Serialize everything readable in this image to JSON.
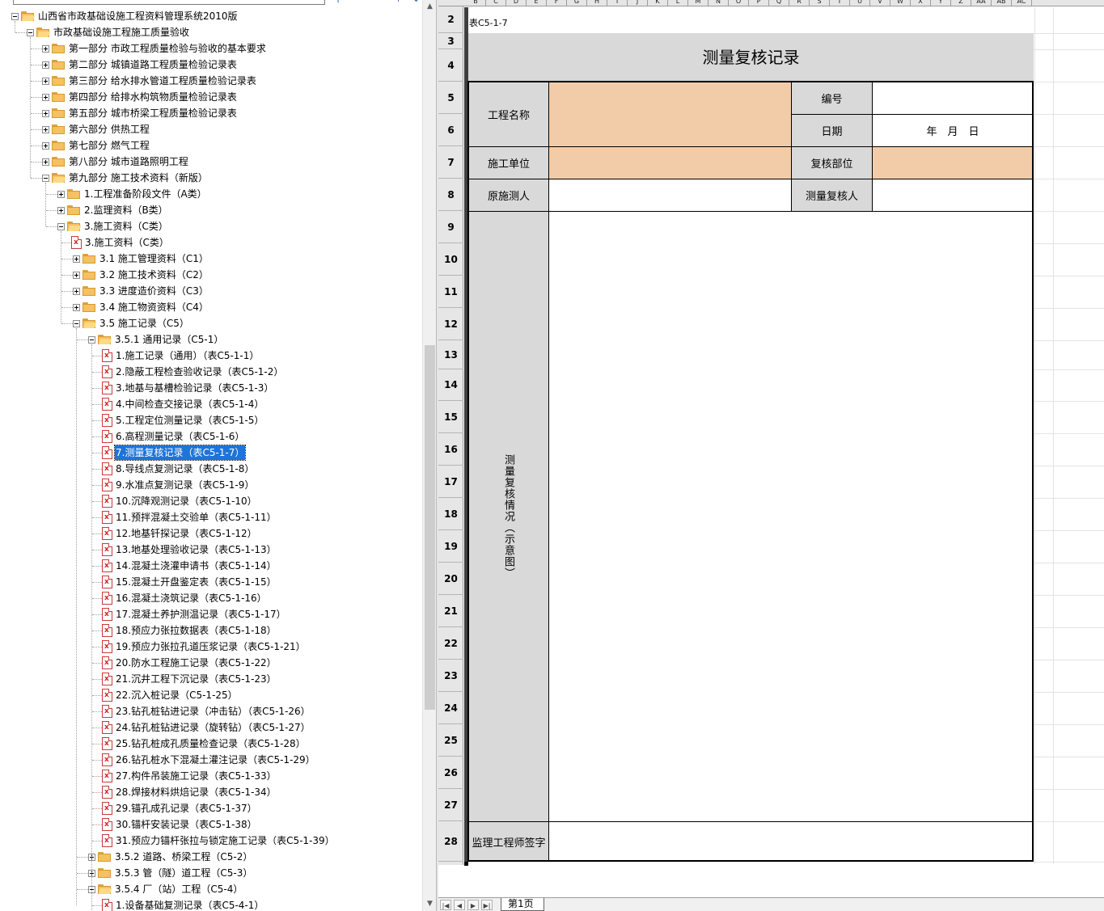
{
  "tree": {
    "root": "山西省市政基础设施工程资料管理系统2010版",
    "items": [
      {
        "label": "市政基础设施工程施工质量验收",
        "level": 1,
        "type": "folder",
        "state": "expanded"
      },
      {
        "label": "第一部分 市政工程质量检验与验收的基本要求",
        "level": 2,
        "type": "folder",
        "state": "collapsed"
      },
      {
        "label": "第二部分 城镇道路工程质量检验记录表",
        "level": 2,
        "type": "folder",
        "state": "collapsed"
      },
      {
        "label": "第三部分 给水排水管道工程质量检验记录表",
        "level": 2,
        "type": "folder",
        "state": "collapsed"
      },
      {
        "label": "第四部分 给排水构筑物质量检验记录表",
        "level": 2,
        "type": "folder",
        "state": "collapsed"
      },
      {
        "label": "第五部分 城市桥梁工程质量检验记录表",
        "level": 2,
        "type": "folder",
        "state": "collapsed"
      },
      {
        "label": "第六部分 供热工程",
        "level": 2,
        "type": "folder",
        "state": "collapsed"
      },
      {
        "label": "第七部分 燃气工程",
        "level": 2,
        "type": "folder",
        "state": "collapsed"
      },
      {
        "label": "第八部分 城市道路照明工程",
        "level": 2,
        "type": "folder",
        "state": "collapsed"
      },
      {
        "label": "第九部分 施工技术资料（新版）",
        "level": 2,
        "type": "folder",
        "state": "expanded"
      },
      {
        "label": "1.工程准备阶段文件（A类）",
        "level": 3,
        "type": "folder",
        "state": "collapsed"
      },
      {
        "label": "2.监理资料（B类）",
        "level": 3,
        "type": "folder",
        "state": "collapsed"
      },
      {
        "label": "3.施工资料（C类）",
        "level": 3,
        "type": "folder",
        "state": "expanded"
      },
      {
        "label": "3.施工资料（C类）",
        "level": 4,
        "type": "file",
        "state": "leaf"
      },
      {
        "label": "3.1 施工管理资料（C1）",
        "level": 4,
        "type": "folder",
        "state": "collapsed"
      },
      {
        "label": "3.2 施工技术资料（C2）",
        "level": 4,
        "type": "folder",
        "state": "collapsed"
      },
      {
        "label": "3.3 进度造价资料（C3）",
        "level": 4,
        "type": "folder",
        "state": "collapsed"
      },
      {
        "label": "3.4 施工物资资料（C4）",
        "level": 4,
        "type": "folder",
        "state": "collapsed"
      },
      {
        "label": "3.5 施工记录（C5）",
        "level": 4,
        "type": "folder",
        "state": "expanded"
      },
      {
        "label": "3.5.1 通用记录（C5-1）",
        "level": 5,
        "type": "folder",
        "state": "expanded"
      },
      {
        "label": "1.施工记录（通用）（表C5-1-1）",
        "level": 6,
        "type": "file",
        "state": "leaf"
      },
      {
        "label": "2.隐蔽工程检查验收记录（表C5-1-2）",
        "level": 6,
        "type": "file",
        "state": "leaf"
      },
      {
        "label": "3.地基与基槽检验记录（表C5-1-3）",
        "level": 6,
        "type": "file",
        "state": "leaf"
      },
      {
        "label": "4.中间检查交接记录（表C5-1-4）",
        "level": 6,
        "type": "file",
        "state": "leaf"
      },
      {
        "label": "5.工程定位测量记录（表C5-1-5）",
        "level": 6,
        "type": "file",
        "state": "leaf"
      },
      {
        "label": "6.高程测量记录（表C5-1-6）",
        "level": 6,
        "type": "file",
        "state": "leaf"
      },
      {
        "label": "7.测量复核记录（表C5-1-7）",
        "level": 6,
        "type": "file",
        "state": "leaf",
        "selected": true
      },
      {
        "label": "8.导线点复测记录（表C5-1-8）",
        "level": 6,
        "type": "file",
        "state": "leaf"
      },
      {
        "label": "9.水准点复测记录（表C5-1-9）",
        "level": 6,
        "type": "file",
        "state": "leaf"
      },
      {
        "label": "10.沉降观测记录（表C5-1-10）",
        "level": 6,
        "type": "file",
        "state": "leaf"
      },
      {
        "label": "11.预拌混凝土交验单（表C5-1-11）",
        "level": 6,
        "type": "file",
        "state": "leaf"
      },
      {
        "label": "12.地基钎探记录（表C5-1-12）",
        "level": 6,
        "type": "file",
        "state": "leaf"
      },
      {
        "label": "13.地基处理验收记录（表C5-1-13）",
        "level": 6,
        "type": "file",
        "state": "leaf"
      },
      {
        "label": "14.混凝土浇灌申请书（表C5-1-14）",
        "level": 6,
        "type": "file",
        "state": "leaf"
      },
      {
        "label": "15.混凝土开盘鉴定表（表C5-1-15）",
        "level": 6,
        "type": "file",
        "state": "leaf"
      },
      {
        "label": "16.混凝土浇筑记录（表C5-1-16）",
        "level": 6,
        "type": "file",
        "state": "leaf"
      },
      {
        "label": "17.混凝土养护测温记录（表C5-1-17）",
        "level": 6,
        "type": "file",
        "state": "leaf"
      },
      {
        "label": "18.预应力张拉数据表（表C5-1-18）",
        "level": 6,
        "type": "file",
        "state": "leaf"
      },
      {
        "label": "19.预应力张拉孔道压浆记录（表C5-1-21）",
        "level": 6,
        "type": "file",
        "state": "leaf"
      },
      {
        "label": "20.防水工程施工记录（表C5-1-22）",
        "level": 6,
        "type": "file",
        "state": "leaf"
      },
      {
        "label": "21.沉井工程下沉记录（表C5-1-23）",
        "level": 6,
        "type": "file",
        "state": "leaf"
      },
      {
        "label": "22.沉入桩记录（C5-1-25）",
        "level": 6,
        "type": "file",
        "state": "leaf"
      },
      {
        "label": "23.钻孔桩钻进记录（冲击钻）（表C5-1-26）",
        "level": 6,
        "type": "file",
        "state": "leaf"
      },
      {
        "label": "24.钻孔桩钻进记录（旋转钻）（表C5-1-27）",
        "level": 6,
        "type": "file",
        "state": "leaf"
      },
      {
        "label": "25.钻孔桩成孔质量检查记录（表C5-1-28）",
        "level": 6,
        "type": "file",
        "state": "leaf"
      },
      {
        "label": "26.钻孔桩水下混凝土灌注记录（表C5-1-29）",
        "level": 6,
        "type": "file",
        "state": "leaf"
      },
      {
        "label": "27.构件吊装施工记录（表C5-1-33）",
        "level": 6,
        "type": "file",
        "state": "leaf"
      },
      {
        "label": "28.焊接材料烘焙记录（表C5-1-34）",
        "level": 6,
        "type": "file",
        "state": "leaf"
      },
      {
        "label": "29.锚孔成孔记录（表C5-1-37）",
        "level": 6,
        "type": "file",
        "state": "leaf"
      },
      {
        "label": "30.锚杆安装记录（表C5-1-38）",
        "level": 6,
        "type": "file",
        "state": "leaf"
      },
      {
        "label": "31.预应力锚杆张拉与锁定施工记录（表C5-1-39）",
        "level": 6,
        "type": "file",
        "state": "leaf"
      },
      {
        "label": "3.5.2 道路、桥梁工程（C5-2）",
        "level": 5,
        "type": "folder",
        "state": "collapsed"
      },
      {
        "label": "3.5.3 管（隧）道工程（C5-3）",
        "level": 5,
        "type": "folder",
        "state": "collapsed"
      },
      {
        "label": "3.5.4 厂（站）工程（C5-4）",
        "level": 5,
        "type": "folder",
        "state": "expanded"
      },
      {
        "label": "1.设备基础复测记录（表C5-4-1）",
        "level": 6,
        "type": "file",
        "state": "leaf"
      }
    ]
  },
  "spreadsheet": {
    "columns": [
      "B",
      "C",
      "D",
      "E",
      "F",
      "G",
      "H",
      "I",
      "J",
      "K",
      "L",
      "M",
      "N",
      "O",
      "P",
      "Q",
      "R",
      "S",
      "T",
      "U",
      "V",
      "W",
      "X",
      "Y",
      "Z",
      "AA",
      "AB",
      "AC"
    ],
    "rows": [
      "2",
      "3",
      "4",
      "5",
      "6",
      "7",
      "8",
      "9",
      "10",
      "11",
      "12",
      "13",
      "14",
      "15",
      "16",
      "17",
      "18",
      "19",
      "20",
      "21",
      "22",
      "23",
      "24",
      "25",
      "26",
      "27",
      "28"
    ],
    "form": {
      "code": "表C5-1-7",
      "title": "测量复核记录",
      "project_name_label": "工程名称",
      "project_name_value": "",
      "number_label": "编号",
      "number_value": "",
      "date_label": "日期",
      "date_value": "年　月　日",
      "contractor_label": "施工单位",
      "contractor_value": "",
      "check_location_label": "复核部位",
      "check_location_value": "",
      "original_surveyor_label": "原施测人",
      "original_surveyor_value": "",
      "check_surveyor_label": "测量复核人",
      "check_surveyor_value": "",
      "status_label": "测量复核情况（示意图）",
      "status_value": "",
      "supervisor_label": "监理工程师签字",
      "supervisor_value": ""
    },
    "sheet_tab": "第1页"
  },
  "colors": {
    "peach_fill": "#f2cca9",
    "label_fill": "#d9d9d9",
    "selection": "#1e74d9"
  }
}
